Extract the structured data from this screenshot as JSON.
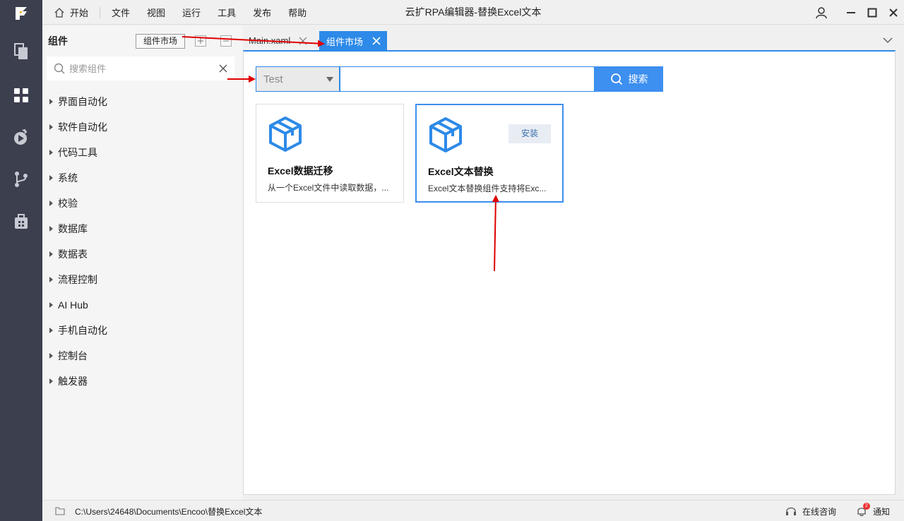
{
  "window": {
    "title": "云扩RPA编辑器-替换Excel文本"
  },
  "menu": {
    "home": "开始",
    "items": [
      "文件",
      "视图",
      "运行",
      "工具",
      "发布",
      "帮助"
    ]
  },
  "rail": {
    "icons": [
      "logo-icon",
      "pages-icon",
      "components-icon",
      "run-debug-icon",
      "branch-icon",
      "package-icon"
    ]
  },
  "panel": {
    "title": "组件",
    "market_button": "组件市场",
    "search_placeholder": "搜索组件",
    "tree": [
      "界面自动化",
      "软件自动化",
      "代码工具",
      "系统",
      "校验",
      "数据库",
      "数据表",
      "流程控制",
      "AI Hub",
      "手机自动化",
      "控制台",
      "触发器"
    ]
  },
  "tabs": {
    "main": "Main.xaml",
    "active": "组件市场"
  },
  "market": {
    "filter_value": "Test",
    "query_value": "",
    "search_button": "搜索",
    "cards": [
      {
        "name": "Excel数据迁移",
        "desc": "从一个Excel文件中读取数据，...",
        "install": ""
      },
      {
        "name": "Excel文本替换",
        "desc": "Excel文本替换组件支持将Exc...",
        "install": "安装"
      }
    ]
  },
  "status": {
    "path": "C:\\Users\\24648\\Documents\\Encoo\\替换Excel文本",
    "consult": "在线咨询",
    "notify": "通知",
    "notify_count": "2"
  },
  "colors": {
    "accent": "#2d8ae8",
    "rail": "#3c3f4e",
    "arrow": "#e00000"
  }
}
